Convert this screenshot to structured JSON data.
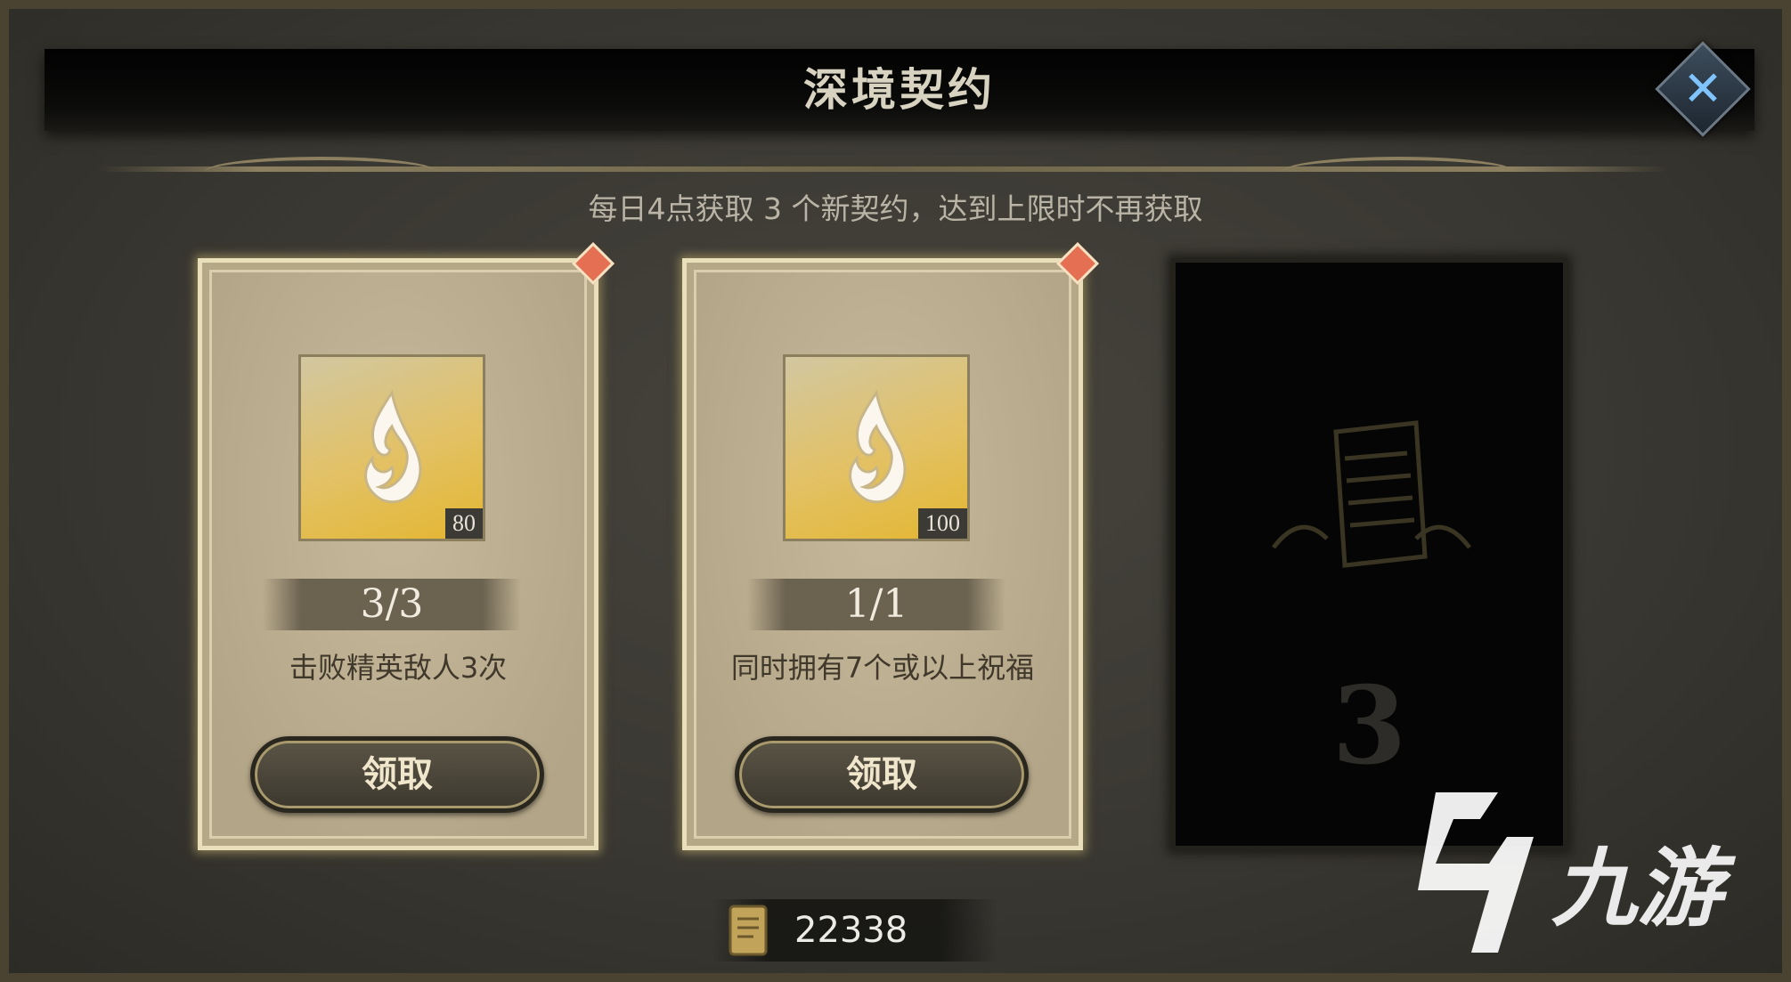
{
  "header": {
    "title": "深境契约",
    "close_icon": "close-icon",
    "subtitle": "每日4点获取 3 个新契约，达到上限时不再获取"
  },
  "contracts": [
    {
      "icon": "flame-rune-icon",
      "reward": "80",
      "progress_text": "3/3",
      "progress_value": 1.0,
      "description": "击败精英敌人3次",
      "button_label": "领取",
      "has_new_badge": true
    },
    {
      "icon": "flame-rune-icon",
      "reward": "100",
      "progress_text": "1/1",
      "progress_value": 1.0,
      "description": "同时拥有7个或以上祝福",
      "button_label": "领取",
      "has_new_badge": true
    }
  ],
  "locked_slot": {
    "number": "3",
    "icon": "scroll-icon"
  },
  "currency": {
    "icon": "scroll-icon",
    "value": "22338"
  },
  "watermark": {
    "text": "九游"
  },
  "colors": {
    "card_background": "#b9ab8e",
    "card_border": "#e9dfba",
    "badge": "#e56f52",
    "icon_gold": "#e3b631",
    "close_accent": "#7fc4ff"
  }
}
